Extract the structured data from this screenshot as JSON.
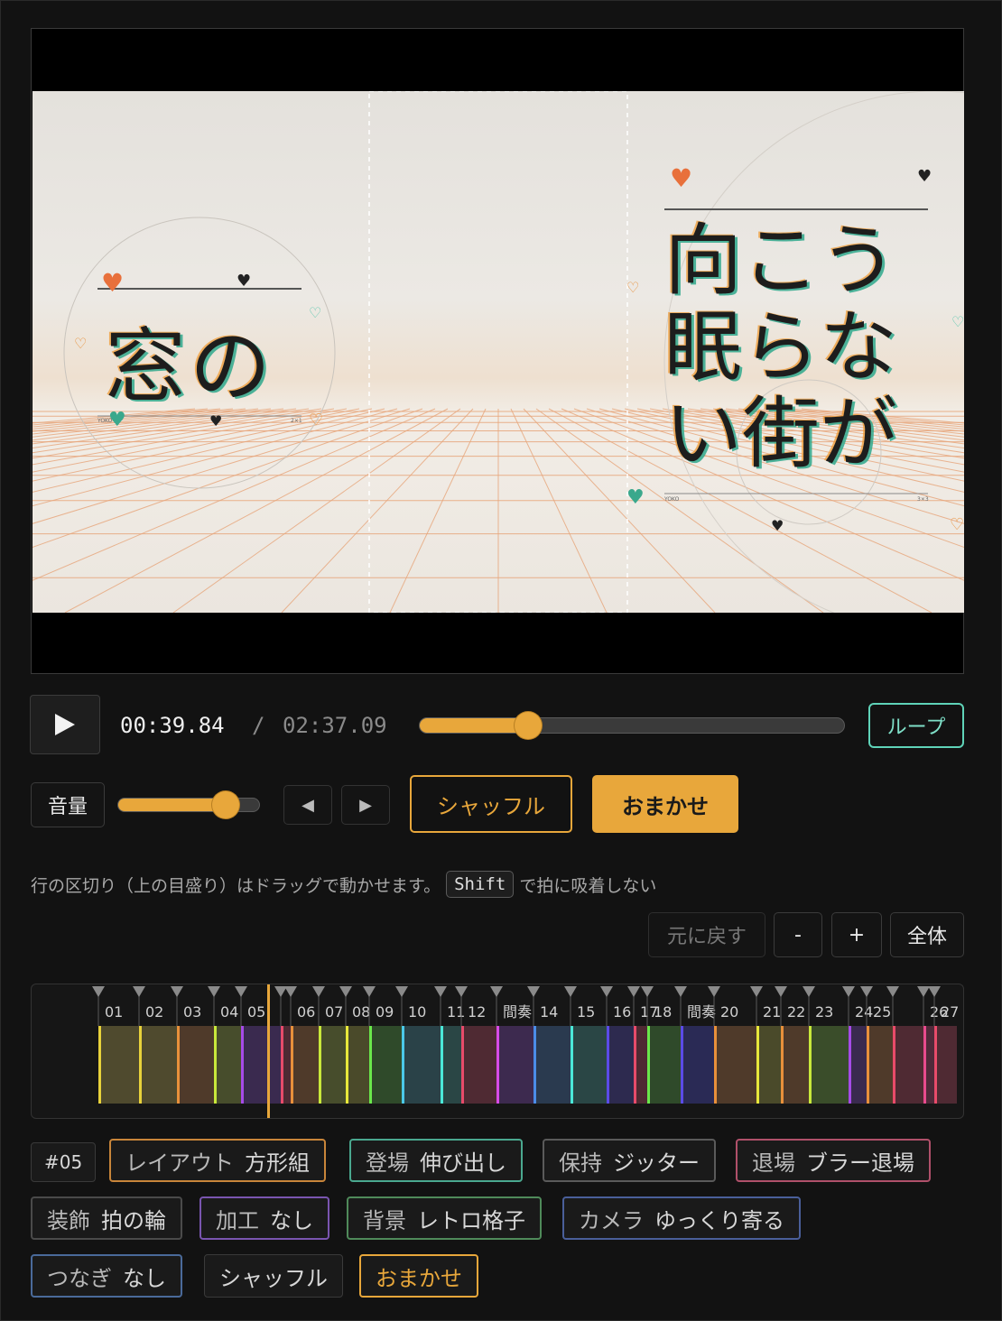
{
  "video": {
    "left_lyric": "窓の",
    "right_lyric_lines": [
      "向こう",
      "眠らな",
      "い街が"
    ],
    "small_left": "YOKO",
    "small_left_count": "2×1",
    "small_right": "YOKO",
    "small_right_count": "3×3"
  },
  "player": {
    "current_time": "00:39.84",
    "separator": "/",
    "total_time": "02:37.09",
    "progress": 0.2535,
    "loop_label": "ループ"
  },
  "controls": {
    "volume_label": "音量",
    "volume": 0.75,
    "prev_icon": "◀",
    "next_icon": "▶",
    "shuffle_label": "シャッフル",
    "omakase_label": "おまかせ"
  },
  "hint": {
    "text_before": "行の区切り（上の目盛り）はドラッグで動かせます。",
    "key": "Shift",
    "text_after": "で拍に吸着しない"
  },
  "toolbar": {
    "undo_label": "元に戻す",
    "zoom_out_label": "-",
    "zoom_in_label": "+",
    "fit_label": "全体"
  },
  "timeline": {
    "segments": [
      {
        "label": "01",
        "start": 74,
        "color": "#e8d23b",
        "fill": "#4f4a2e"
      },
      {
        "label": "02",
        "start": 119,
        "color": "#e8d23b",
        "fill": "#4f4a2e"
      },
      {
        "label": "03",
        "start": 161,
        "color": "#e8903b",
        "fill": "#4f3a2a"
      },
      {
        "label": "04",
        "start": 202,
        "color": "#c8e83b",
        "fill": "#474d2c"
      },
      {
        "label": "05",
        "start": 232,
        "color": "#a64be8",
        "fill": "#3a2a4f"
      },
      {
        "label": "",
        "start": 276,
        "color": "#e84b6a",
        "fill": "#4f2a33"
      },
      {
        "label": "06",
        "start": 287,
        "color": "#e8903b",
        "fill": "#4f3a2a"
      },
      {
        "label": "07",
        "start": 318,
        "color": "#c8e83b",
        "fill": "#474d2c"
      },
      {
        "label": "08",
        "start": 348,
        "color": "#e8e83b",
        "fill": "#4a4a2a"
      },
      {
        "label": "09",
        "start": 374,
        "color": "#6ae84b",
        "fill": "#2f4a2a"
      },
      {
        "label": "10",
        "start": 410,
        "color": "#4bc8e8",
        "fill": "#2a4248"
      },
      {
        "label": "11",
        "start": 453,
        "color": "#4be8d8",
        "fill": "#2a4645"
      },
      {
        "label": "12",
        "start": 476,
        "color": "#e84b6a",
        "fill": "#4f2a33"
      },
      {
        "label": "間奏",
        "start": 515,
        "color": "#d84be8",
        "fill": "#3d2a4f"
      },
      {
        "label": "14",
        "start": 556,
        "color": "#4b8de8",
        "fill": "#2a3a4f"
      },
      {
        "label": "15",
        "start": 597,
        "color": "#4be8d8",
        "fill": "#2a4645"
      },
      {
        "label": "16",
        "start": 637,
        "color": "#5b4be8",
        "fill": "#2d2a4f"
      },
      {
        "label": "17",
        "start": 667,
        "color": "#e84b6a",
        "fill": "#4f2a33"
      },
      {
        "label": "18",
        "start": 682,
        "color": "#6ae84b",
        "fill": "#2f4a2a"
      },
      {
        "label": "間奏",
        "start": 719,
        "color": "#5b4be8",
        "fill": "#2a2a55"
      },
      {
        "label": "20",
        "start": 756,
        "color": "#e8903b",
        "fill": "#4f3a2a"
      },
      {
        "label": "21",
        "start": 803,
        "color": "#e8e83b",
        "fill": "#4a4a2a"
      },
      {
        "label": "22",
        "start": 830,
        "color": "#e8903b",
        "fill": "#4f3a2a"
      },
      {
        "label": "23",
        "start": 861,
        "color": "#c8e83b",
        "fill": "#3a4d2a"
      },
      {
        "label": "24",
        "start": 905,
        "color": "#a64be8",
        "fill": "#3a2a4f"
      },
      {
        "label": "25",
        "start": 925,
        "color": "#e8903b",
        "fill": "#4f3a2a"
      },
      {
        "label": "",
        "start": 954,
        "color": "#e84b6a",
        "fill": "#4f2a33"
      },
      {
        "label": "26",
        "start": 988,
        "color": "#e84b8d",
        "fill": "#4f2a3a"
      },
      {
        "label": "27",
        "start": 1000,
        "color": "#e84b6a",
        "fill": "#4f2a33"
      }
    ],
    "end": 1025,
    "playhead": 262
  },
  "tags": {
    "index": "#05",
    "layout_key": "レイアウト",
    "layout_val": "方形組",
    "enter_key": "登場",
    "enter_val": "伸び出し",
    "hold_key": "保持",
    "hold_val": "ジッター",
    "exit_key": "退場",
    "exit_val": "ブラー退場",
    "deco_key": "装飾",
    "deco_val": "拍の輪",
    "proc_key": "加工",
    "proc_val": "なし",
    "bg_key": "背景",
    "bg_val": "レトロ格子",
    "camera_key": "カメラ",
    "camera_val": "ゆっくり寄る",
    "link_key": "つなぎ",
    "link_val": "なし",
    "shuffle_label": "シャッフル",
    "omakase_label": "おまかせ"
  },
  "colors": {
    "accent": "#e8a73b",
    "loop": "#5fd3b8"
  }
}
